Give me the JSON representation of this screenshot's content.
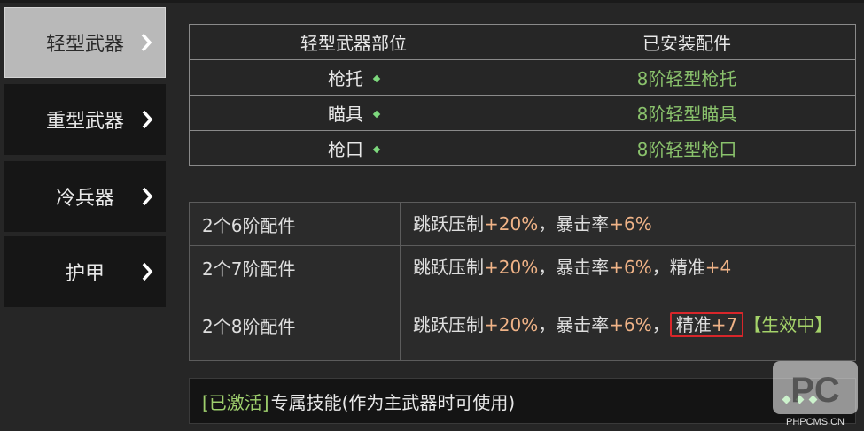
{
  "sidebar": {
    "items": [
      {
        "label": "轻型武器",
        "active": true
      },
      {
        "label": "重型武器",
        "active": false
      },
      {
        "label": "冷兵器",
        "active": false
      },
      {
        "label": "护甲",
        "active": false
      }
    ]
  },
  "parts_table": {
    "headers": [
      "轻型武器部位",
      "已安装配件"
    ],
    "rows": [
      {
        "slot": "枪托",
        "installed": "8阶轻型枪托"
      },
      {
        "slot": "瞄具",
        "installed": "8阶轻型瞄具"
      },
      {
        "slot": "枪口",
        "installed": "8阶轻型枪口"
      }
    ]
  },
  "set_bonus": {
    "rows": [
      {
        "condition": "2个6阶配件",
        "t1": "跳跃压制",
        "v1": "+20%",
        "sep1": "，",
        "t2": "暴击率",
        "v2": "+6%",
        "sep2": "",
        "t3": "",
        "v3": "",
        "status": ""
      },
      {
        "condition": "2个7阶配件",
        "t1": "跳跃压制",
        "v1": "+20%",
        "sep1": "，",
        "t2": "暴击率",
        "v2": "+6%",
        "sep2": "，",
        "t3": "精准",
        "v3": "+4",
        "status": ""
      },
      {
        "condition": "2个8阶配件",
        "t1": "跳跃压制",
        "v1": "+20%",
        "sep1": "，",
        "t2": "暴击率",
        "v2": "+6%",
        "sep2": "，",
        "t3": "精准",
        "v3": "+7",
        "status": "【生效中】"
      }
    ]
  },
  "bottom_bar": {
    "tag": "[已激活]",
    "skill": "专属技能(作为主武器时可使用)"
  },
  "watermark": {
    "text": "PHPCMS.CN"
  },
  "colors": {
    "accent_green": "#8ac26c",
    "value_orange": "#f0b387",
    "highlight_red": "#d8262a"
  }
}
